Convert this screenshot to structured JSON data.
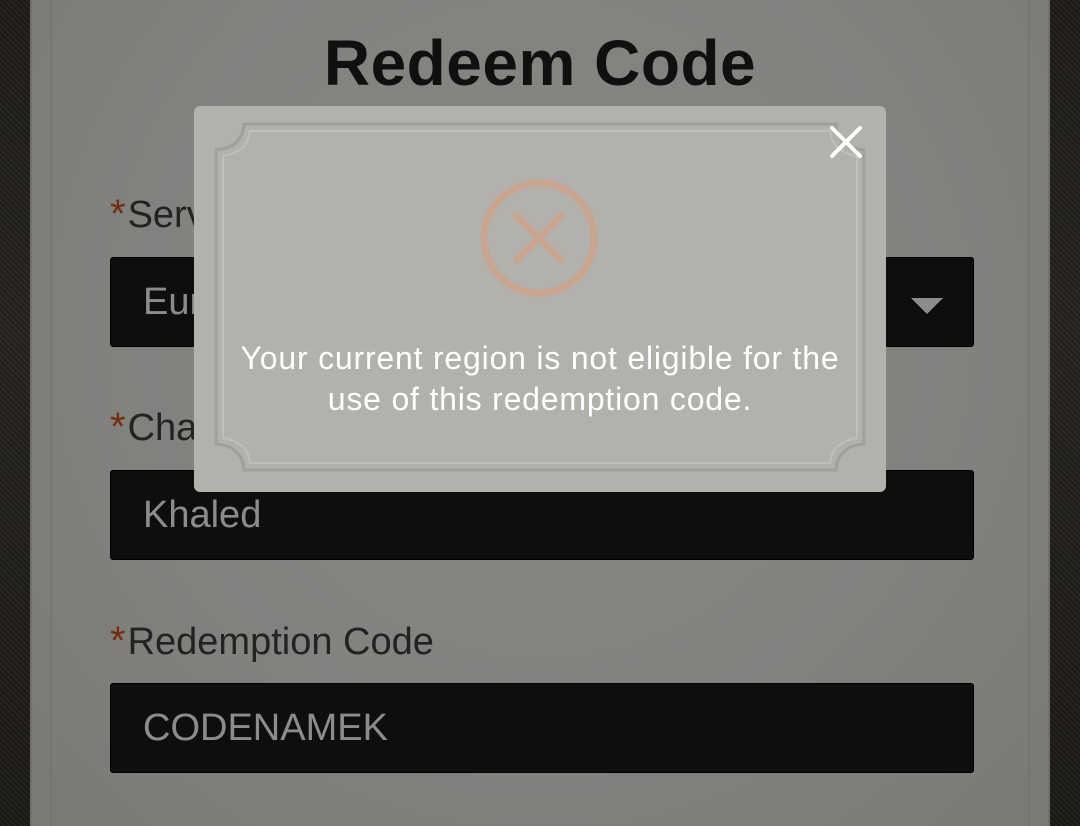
{
  "form": {
    "title": "Redeem Code",
    "required_mark": "*",
    "server": {
      "label": "Server",
      "value": "Europe"
    },
    "character": {
      "label": "Character",
      "value": "Khaled"
    },
    "code": {
      "label": "Redemption Code",
      "value": "CODENAMEK"
    }
  },
  "modal": {
    "message": "Your current region is not eligible for the use of this redemption code.",
    "icons": {
      "close": "close-icon",
      "error": "error-circle-x-icon"
    }
  },
  "colors": {
    "required": "#d2531c",
    "field_bg": "#1b1b1b",
    "modal_bg": "#b2b1ab",
    "error_icon": "#c9a590"
  }
}
